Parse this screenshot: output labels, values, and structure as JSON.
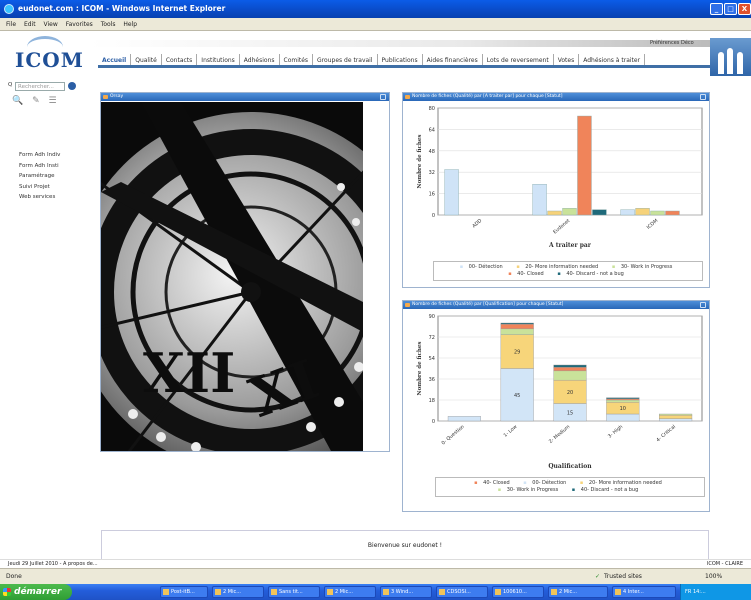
{
  "window": {
    "title": "eudonet.com : ICOM - Windows Internet Explorer",
    "min": "_",
    "max": "□",
    "close": "X"
  },
  "menu": [
    "File",
    "Edit",
    "View",
    "Favorites",
    "Tools",
    "Help"
  ],
  "logo": "ICOM",
  "user_links": "Préférences  Déco",
  "nav": [
    "Accueil",
    "Qualité",
    "Contacts",
    "Institutions",
    "Adhésions",
    "Comités",
    "Groupes de travail",
    "Publications",
    "Aides financières",
    "Lots de reversement",
    "Votes",
    "Adhésions à traiter"
  ],
  "search": {
    "label": "Q",
    "placeholder": "Rechercher..."
  },
  "side_icons": {
    "search": "🔍",
    "tools": "✎",
    "list": "☰"
  },
  "leftmenu": [
    "Form Adh Indiv",
    "Form Adh Insti",
    "Paramétrage",
    "Suivi Projet",
    "Web services"
  ],
  "panels": {
    "photo_title": "Orsay",
    "chart1_title": "Nombre de fiches (Qualité) par [A traiter par] pour chaque [Statut]",
    "chart2_title": "Nombre de fiches (Qualité) par [Qualification] pour chaque [Statut]"
  },
  "chart_data": [
    {
      "type": "bar",
      "title": "",
      "xlabel": "A traiter par",
      "ylabel": "Nombre de fiches",
      "ylim": [
        0,
        80
      ],
      "yticks": [
        0,
        16,
        32,
        48,
        64,
        80
      ],
      "categories": [
        "ADD",
        "Eudonet",
        "ICOM"
      ],
      "series": [
        {
          "name": "00- Détection",
          "color": "#cfe3f7",
          "values": [
            34,
            23,
            4
          ]
        },
        {
          "name": "20- More information needed",
          "color": "#f6d27a",
          "values": [
            0,
            3,
            5
          ]
        },
        {
          "name": "30- Work in Progress",
          "color": "#c9e29a",
          "values": [
            0,
            5,
            3
          ]
        },
        {
          "name": "40- Closed",
          "color": "#f0845a",
          "values": [
            0,
            74,
            3
          ]
        },
        {
          "name": "40- Discard - not a bug",
          "color": "#1f6a7a",
          "values": [
            0,
            4,
            0
          ]
        }
      ],
      "legend": [
        "00- Détection",
        "20- More information needed",
        "30- Work in Progress",
        "40- Closed",
        "40- Discard - not a bug"
      ]
    },
    {
      "type": "bar",
      "stacked": true,
      "title": "",
      "xlabel": "Qualification",
      "ylabel": "Nombre de fiches",
      "ylim": [
        0,
        90
      ],
      "yticks": [
        0,
        18,
        36,
        54,
        72,
        90
      ],
      "categories": [
        "0- Question",
        "1- Low",
        "2- Medium",
        "3- High",
        "4- Critical"
      ],
      "series": [
        {
          "name": "00- Détection",
          "color": "#d2e5f7",
          "values": [
            4,
            45,
            15,
            6,
            2
          ]
        },
        {
          "name": "20- More information needed",
          "color": "#f7d57a",
          "values": [
            0,
            29,
            20,
            10,
            3
          ]
        },
        {
          "name": "30- Work in Progress",
          "color": "#c9e29a",
          "values": [
            0,
            5,
            8,
            2,
            1
          ]
        },
        {
          "name": "40- Closed",
          "color": "#f0845a",
          "values": [
            0,
            4,
            3,
            1,
            0
          ]
        },
        {
          "name": "40- Discard - not a bug",
          "color": "#1f6a7a",
          "values": [
            0,
            1,
            2,
            1,
            0
          ]
        }
      ],
      "data_labels": {
        "1- Low": [
          45,
          29
        ],
        "2- Medium": [
          15,
          20
        ],
        "3- High": [
          6,
          10
        ]
      },
      "legend": [
        "40- Closed",
        "00- Détection",
        "20- More information needed",
        "30- Work in Progress",
        "40- Discard - not a bug"
      ]
    }
  ],
  "welcome": "Bienvenue sur eudonet !",
  "footer": {
    "left": "Jeudi 29 Juillet 2010 - A propos de...",
    "right": "ICOM - CLAIRE"
  },
  "status": {
    "left": "Done",
    "zone": "Trusted sites",
    "zoom": "100%"
  },
  "taskbar": {
    "start": "démarrer",
    "items": [
      "Post-itB...",
      "2 Mic...",
      "Sans tit...",
      "2 Mic...",
      "3 Wind...",
      "CDSOSI...",
      "100610...",
      "2 Mic...",
      "4 Inter..."
    ],
    "tray": "FR  14:..."
  }
}
